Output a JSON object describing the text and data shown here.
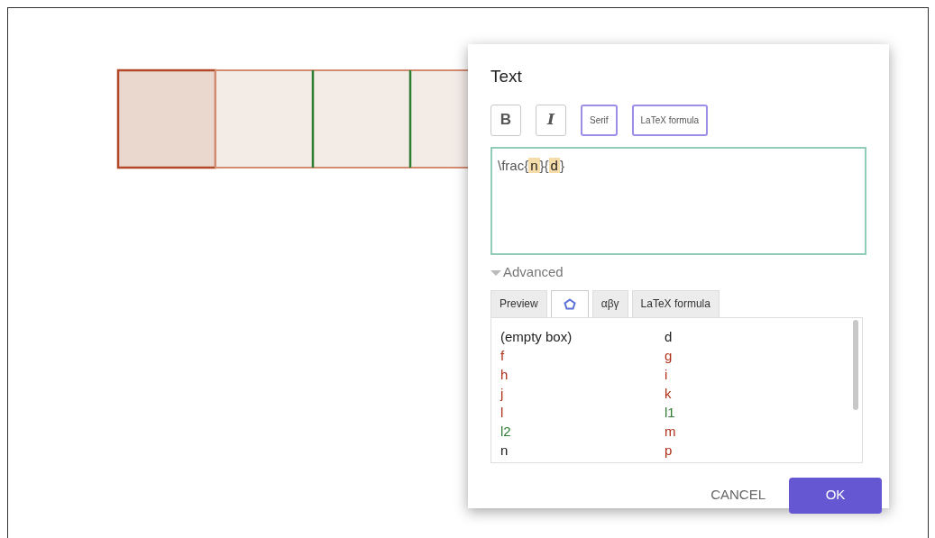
{
  "canvas": {
    "segments": [
      {
        "kind": "first"
      },
      {
        "kind": "plain"
      },
      {
        "kind": "plain"
      },
      {
        "kind": "plain"
      }
    ]
  },
  "dialog": {
    "title": "Text",
    "format_buttons": [
      {
        "label": "B",
        "kind": "bold",
        "on": false
      },
      {
        "label": "I",
        "kind": "italic",
        "on": false
      },
      {
        "label": "Serif",
        "kind": "small",
        "on": true
      },
      {
        "label": "LaTeX formula",
        "kind": "small",
        "on": true
      }
    ],
    "editor": [
      {
        "text": "\\frac{",
        "highlighted": false
      },
      {
        "text": "n",
        "highlighted": true
      },
      {
        "text": "}{",
        "highlighted": false
      },
      {
        "text": "d",
        "highlighted": true
      },
      {
        "text": "}",
        "highlighted": false
      }
    ],
    "advanced": {
      "label": "Advanced",
      "expanded": true
    },
    "tabs": [
      {
        "label": "Preview",
        "kind": "text",
        "selected": false
      },
      {
        "kind": "icon",
        "selected": true
      },
      {
        "label": "αβγ",
        "kind": "text",
        "selected": false
      },
      {
        "label": "LaTeX formula",
        "kind": "text",
        "selected": false
      }
    ],
    "objects": [
      {
        "label": "(empty box)",
        "color": "#222222"
      },
      {
        "label": "d",
        "color": "#222222"
      },
      {
        "label": "f",
        "color": "#b0301a"
      },
      {
        "label": "g",
        "color": "#b0301a"
      },
      {
        "label": "h",
        "color": "#b0301a"
      },
      {
        "label": "i",
        "color": "#b0301a"
      },
      {
        "label": "j",
        "color": "#b0301a"
      },
      {
        "label": "k",
        "color": "#b0301a"
      },
      {
        "label": "l",
        "color": "#b0301a"
      },
      {
        "label": "l1",
        "color": "#2e7d32"
      },
      {
        "label": "l2",
        "color": "#2e7d32"
      },
      {
        "label": "m",
        "color": "#b0301a"
      },
      {
        "label": "n",
        "color": "#222222"
      },
      {
        "label": "p",
        "color": "#b0301a"
      }
    ],
    "buttons": [
      {
        "label": "CANCEL",
        "kind": "text"
      },
      {
        "label": "OK",
        "kind": "primary"
      }
    ]
  }
}
